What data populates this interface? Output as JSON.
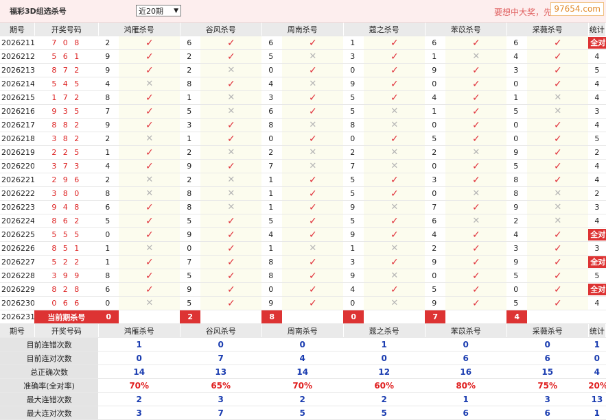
{
  "header": {
    "title": "福彩3D组选杀号",
    "period_select": "近20期",
    "slogan": "要想中大奖，先",
    "watermark": "97654.com"
  },
  "columns": {
    "issue": "期号",
    "draw": "开奖号码",
    "experts": [
      "鸿雁杀号",
      "谷风杀号",
      "周南杀号",
      "蔻之杀号",
      "苯苡杀号",
      "采薇杀号"
    ],
    "stats": "统计"
  },
  "rows": [
    {
      "issue": "2026211",
      "draw": "7 0 8",
      "picks": [
        [
          "2",
          "ok"
        ],
        [
          "6",
          "ok"
        ],
        [
          "6",
          "ok"
        ],
        [
          "1",
          "ok"
        ],
        [
          "6",
          "ok"
        ],
        [
          "6",
          "ok"
        ]
      ],
      "stat": "全对",
      "stat_badge": true
    },
    {
      "issue": "2026212",
      "draw": "5 6 1",
      "picks": [
        [
          "9",
          "ok"
        ],
        [
          "2",
          "ok"
        ],
        [
          "5",
          "no"
        ],
        [
          "3",
          "ok"
        ],
        [
          "1",
          "no"
        ],
        [
          "4",
          "ok"
        ]
      ],
      "stat": "4"
    },
    {
      "issue": "2026213",
      "draw": "8 7 2",
      "picks": [
        [
          "9",
          "ok"
        ],
        [
          "2",
          "no"
        ],
        [
          "0",
          "ok"
        ],
        [
          "0",
          "ok"
        ],
        [
          "9",
          "ok"
        ],
        [
          "3",
          "ok"
        ]
      ],
      "stat": "5"
    },
    {
      "issue": "2026214",
      "draw": "5 4 5",
      "picks": [
        [
          "4",
          "no"
        ],
        [
          "8",
          "ok"
        ],
        [
          "4",
          "no"
        ],
        [
          "9",
          "ok"
        ],
        [
          "0",
          "ok"
        ],
        [
          "0",
          "ok"
        ]
      ],
      "stat": "4"
    },
    {
      "issue": "2026215",
      "draw": "1 7 2",
      "picks": [
        [
          "8",
          "ok"
        ],
        [
          "1",
          "no"
        ],
        [
          "3",
          "ok"
        ],
        [
          "5",
          "ok"
        ],
        [
          "4",
          "ok"
        ],
        [
          "1",
          "no"
        ]
      ],
      "stat": "4"
    },
    {
      "issue": "2026216",
      "draw": "9 3 5",
      "picks": [
        [
          "7",
          "ok"
        ],
        [
          "5",
          "no"
        ],
        [
          "6",
          "ok"
        ],
        [
          "5",
          "no"
        ],
        [
          "1",
          "ok"
        ],
        [
          "5",
          "no"
        ]
      ],
      "stat": "3"
    },
    {
      "issue": "2026217",
      "draw": "8 8 2",
      "picks": [
        [
          "9",
          "ok"
        ],
        [
          "3",
          "ok"
        ],
        [
          "8",
          "no"
        ],
        [
          "8",
          "no"
        ],
        [
          "0",
          "ok"
        ],
        [
          "0",
          "ok"
        ]
      ],
      "stat": "4"
    },
    {
      "issue": "2026218",
      "draw": "3 8 2",
      "picks": [
        [
          "2",
          "no"
        ],
        [
          "1",
          "ok"
        ],
        [
          "0",
          "ok"
        ],
        [
          "0",
          "ok"
        ],
        [
          "5",
          "ok"
        ],
        [
          "0",
          "ok"
        ]
      ],
      "stat": "5"
    },
    {
      "issue": "2026219",
      "draw": "2 2 5",
      "picks": [
        [
          "1",
          "ok"
        ],
        [
          "2",
          "no"
        ],
        [
          "2",
          "no"
        ],
        [
          "2",
          "no"
        ],
        [
          "2",
          "no"
        ],
        [
          "9",
          "ok"
        ]
      ],
      "stat": "2"
    },
    {
      "issue": "2026220",
      "draw": "3 7 3",
      "picks": [
        [
          "4",
          "ok"
        ],
        [
          "9",
          "ok"
        ],
        [
          "7",
          "no"
        ],
        [
          "7",
          "no"
        ],
        [
          "0",
          "ok"
        ],
        [
          "5",
          "ok"
        ]
      ],
      "stat": "4"
    },
    {
      "issue": "2026221",
      "draw": "2 9 6",
      "picks": [
        [
          "2",
          "no"
        ],
        [
          "2",
          "no"
        ],
        [
          "1",
          "ok"
        ],
        [
          "5",
          "ok"
        ],
        [
          "3",
          "ok"
        ],
        [
          "8",
          "ok"
        ]
      ],
      "stat": "4"
    },
    {
      "issue": "2026222",
      "draw": "3 8 0",
      "picks": [
        [
          "8",
          "no"
        ],
        [
          "8",
          "no"
        ],
        [
          "1",
          "ok"
        ],
        [
          "5",
          "ok"
        ],
        [
          "0",
          "no"
        ],
        [
          "8",
          "no"
        ]
      ],
      "stat": "2"
    },
    {
      "issue": "2026223",
      "draw": "9 4 8",
      "picks": [
        [
          "6",
          "ok"
        ],
        [
          "8",
          "no"
        ],
        [
          "1",
          "ok"
        ],
        [
          "9",
          "no"
        ],
        [
          "7",
          "ok"
        ],
        [
          "9",
          "no"
        ]
      ],
      "stat": "3"
    },
    {
      "issue": "2026224",
      "draw": "8 6 2",
      "picks": [
        [
          "5",
          "ok"
        ],
        [
          "5",
          "ok"
        ],
        [
          "5",
          "ok"
        ],
        [
          "5",
          "ok"
        ],
        [
          "6",
          "no"
        ],
        [
          "2",
          "no"
        ]
      ],
      "stat": "4"
    },
    {
      "issue": "2026225",
      "draw": "5 5 5",
      "picks": [
        [
          "0",
          "ok"
        ],
        [
          "9",
          "ok"
        ],
        [
          "4",
          "ok"
        ],
        [
          "9",
          "ok"
        ],
        [
          "4",
          "ok"
        ],
        [
          "4",
          "ok"
        ]
      ],
      "stat": "全对",
      "stat_badge": true
    },
    {
      "issue": "2026226",
      "draw": "8 5 1",
      "picks": [
        [
          "1",
          "no"
        ],
        [
          "0",
          "ok"
        ],
        [
          "1",
          "no"
        ],
        [
          "1",
          "no"
        ],
        [
          "2",
          "ok"
        ],
        [
          "3",
          "ok"
        ]
      ],
      "stat": "3"
    },
    {
      "issue": "2026227",
      "draw": "5 2 2",
      "picks": [
        [
          "1",
          "ok"
        ],
        [
          "7",
          "ok"
        ],
        [
          "8",
          "ok"
        ],
        [
          "3",
          "ok"
        ],
        [
          "9",
          "ok"
        ],
        [
          "9",
          "ok"
        ]
      ],
      "stat": "全对",
      "stat_badge": true
    },
    {
      "issue": "2026228",
      "draw": "3 9 9",
      "picks": [
        [
          "8",
          "ok"
        ],
        [
          "5",
          "ok"
        ],
        [
          "8",
          "ok"
        ],
        [
          "9",
          "no"
        ],
        [
          "0",
          "ok"
        ],
        [
          "5",
          "ok"
        ]
      ],
      "stat": "5"
    },
    {
      "issue": "2026229",
      "draw": "8 2 8",
      "picks": [
        [
          "6",
          "ok"
        ],
        [
          "9",
          "ok"
        ],
        [
          "0",
          "ok"
        ],
        [
          "4",
          "ok"
        ],
        [
          "5",
          "ok"
        ],
        [
          "0",
          "ok"
        ]
      ],
      "stat": "全对",
      "stat_badge": true
    },
    {
      "issue": "2026230",
      "draw": "0 6 6",
      "picks": [
        [
          "0",
          "no"
        ],
        [
          "5",
          "ok"
        ],
        [
          "9",
          "ok"
        ],
        [
          "0",
          "no"
        ],
        [
          "9",
          "ok"
        ],
        [
          "5",
          "ok"
        ]
      ],
      "stat": "4"
    }
  ],
  "current": {
    "issue": "2026231",
    "label": "当前期杀号",
    "picks": [
      "0",
      "2",
      "8",
      "0",
      "7",
      "4"
    ]
  },
  "summary": [
    {
      "label": "目前连错次数",
      "values": [
        "1",
        "0",
        "0",
        "1",
        "0",
        "0",
        "1"
      ],
      "red": false
    },
    {
      "label": "目前连对次数",
      "values": [
        "0",
        "7",
        "4",
        "0",
        "6",
        "6",
        "0"
      ],
      "red": false
    },
    {
      "label": "总正确次数",
      "values": [
        "14",
        "13",
        "14",
        "12",
        "16",
        "15",
        "4"
      ],
      "red": false
    },
    {
      "label": "准确率(全对率)",
      "values": [
        "70%",
        "65%",
        "70%",
        "60%",
        "80%",
        "75%",
        "20%"
      ],
      "red": true
    },
    {
      "label": "最大连错次数",
      "values": [
        "2",
        "3",
        "2",
        "2",
        "1",
        "3",
        "13"
      ],
      "red": false
    },
    {
      "label": "最大连对次数",
      "values": [
        "3",
        "7",
        "5",
        "5",
        "6",
        "6",
        "1"
      ],
      "red": false
    }
  ],
  "icons": {
    "ok": "check-icon",
    "no": "cross-icon"
  },
  "colors": {
    "red": "#d33333",
    "blue": "#1a3cb0",
    "cell_bg": "#fcfcee",
    "header_bg": "#eaeaea"
  }
}
